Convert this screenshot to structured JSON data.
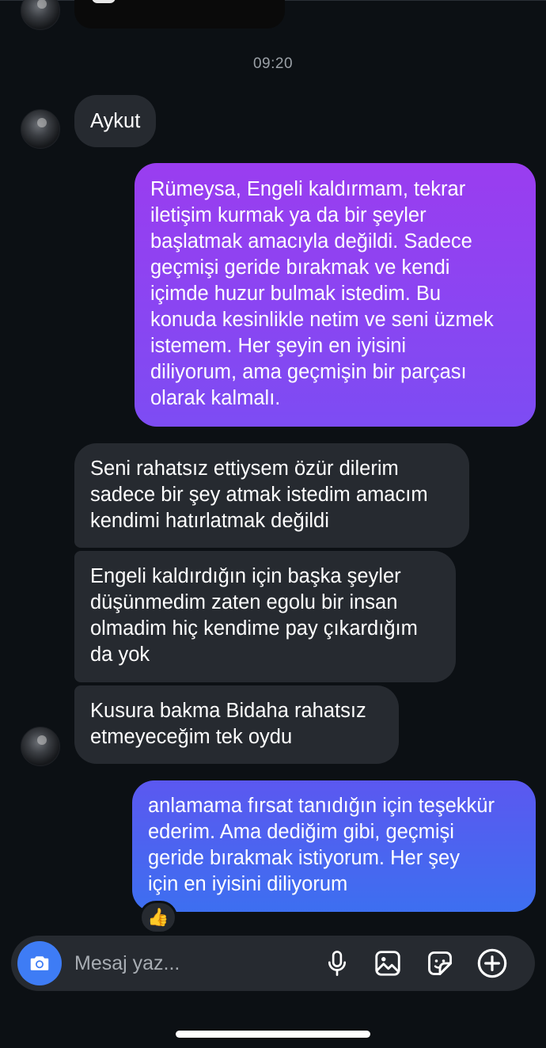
{
  "thread": {
    "timestamp": "09:20",
    "messages": [
      {
        "from": "them",
        "lines": [
          "Aykut"
        ]
      },
      {
        "from": "me",
        "lines": [
          "Rümeysa, Engeli kaldırmam, tekrar",
          "iletişim kurmak ya da bir şeyler",
          "başlatmak amacıyla değildi. Sadece",
          "geçmişi geride bırakmak ve kendi",
          "içimde huzur bulmak istedim. Bu",
          "konuda kesinlikle netim ve seni üzmek",
          "istemem. Her şeyin en iyisini",
          "diliyorum, ama geçmişin bir parçası",
          "olarak kalmalı."
        ]
      },
      {
        "from": "them",
        "lines": [
          "Seni rahatsız ettiysem özür dilerim",
          "sadece bir şey atmak istedim amacım",
          "kendimi hatırlatmak değildi"
        ]
      },
      {
        "from": "them",
        "lines": [
          "Engeli kaldırdığın için başka şeyler",
          "düşünmedim zaten egolu bir insan",
          "olmadim hiç kendime pay çıkardığım",
          "da yok"
        ]
      },
      {
        "from": "them",
        "lines": [
          "Kusura bakma Bidaha rahatsız",
          "etmeyeceğim tek oydu"
        ]
      },
      {
        "from": "me",
        "lines": [
          "anlamama fırsat tanıdığın için teşekkür",
          "ederim. Ama dediğim gibi, geçmişi",
          "geride bırakmak istiyorum. Her şey",
          "için en iyisini diliyorum"
        ]
      }
    ],
    "reaction": "👍"
  },
  "composer": {
    "placeholder": "Mesaj yaz...",
    "icons": [
      "camera-icon",
      "microphone-icon",
      "gallery-icon",
      "sticker-icon",
      "plus-icon"
    ]
  },
  "colors": {
    "background": "#0c1014",
    "received_bubble": "#262a30",
    "sent_bubble_purple": "#8a44f2",
    "sent_bubble_blue": "#4a64f0",
    "camera_button": "#3e7cf5"
  }
}
